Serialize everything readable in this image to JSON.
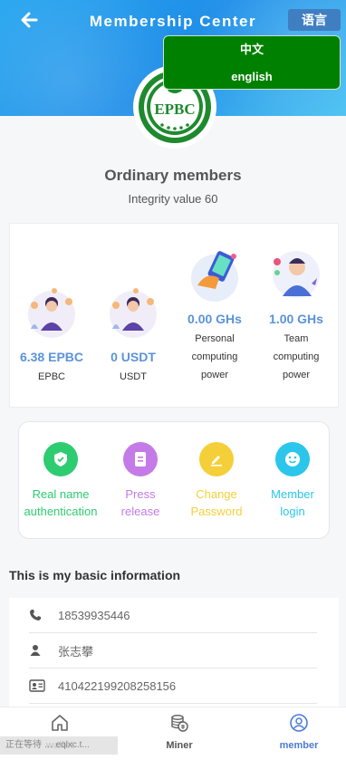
{
  "header": {
    "title": "Membership Center",
    "language_button": "语言",
    "language_options": [
      "中文",
      "english"
    ],
    "back_icon": "arrow-left-icon",
    "logo_text": "EPBC",
    "colors": {
      "header_gradient_start": "#29a7f0",
      "header_gradient_end": "#4ec3f2",
      "language_menu": "#008000",
      "language_button": "#3f7fc1"
    }
  },
  "member": {
    "level": "Ordinary members",
    "integrity": "Integrity value 60"
  },
  "stats": [
    {
      "value": "6.38 EPBC",
      "label": "EPBC"
    },
    {
      "value": "0 USDT",
      "label": "USDT"
    },
    {
      "value": "0.00 GHs",
      "label_lines": [
        "Personal",
        "computing",
        "power"
      ]
    },
    {
      "value": "1.00 GHs",
      "label_lines": [
        "Team",
        "computing",
        "power"
      ]
    }
  ],
  "actions": [
    {
      "lines": [
        "Real name",
        "authentication"
      ],
      "color": "#2ecc71",
      "icon": "shield-icon"
    },
    {
      "lines": [
        "Press",
        "release"
      ],
      "color": "#c47be8",
      "icon": "document-icon"
    },
    {
      "lines": [
        "Change",
        "Password"
      ],
      "color": "#f5cf3a",
      "icon": "pencil-icon"
    },
    {
      "lines": [
        "Member",
        "login"
      ],
      "color": "#2bc6ea",
      "icon": "smiley-icon"
    }
  ],
  "info": {
    "title": "This is my basic information",
    "rows": [
      {
        "icon": "phone-icon",
        "text": "18539935446"
      },
      {
        "icon": "user-icon",
        "text": "张志攀"
      },
      {
        "icon": "id-card-icon",
        "text": "410422199208258156"
      }
    ]
  },
  "tabbar": {
    "tabs": [
      {
        "label": "wallet",
        "icon": "home-icon"
      },
      {
        "label": "Miner",
        "icon": "coins-icon"
      },
      {
        "label": "member",
        "icon": "member-icon",
        "active": true
      }
    ]
  },
  "status_overlay": "正在等待 … eqlxc.t..."
}
